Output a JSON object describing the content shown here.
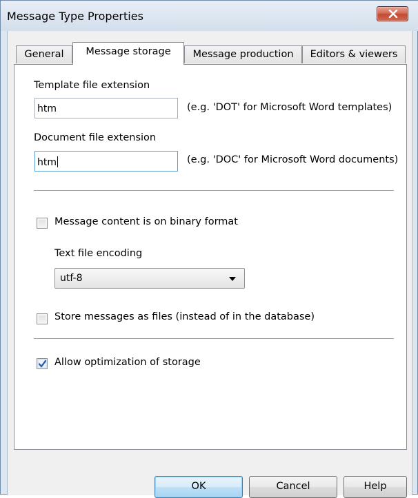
{
  "window": {
    "title": "Message Type Properties"
  },
  "tabs": [
    {
      "label": "General",
      "active": false
    },
    {
      "label": "Message storage",
      "active": true
    },
    {
      "label": "Message production",
      "active": false
    },
    {
      "label": "Editors & viewers",
      "active": false
    }
  ],
  "storage": {
    "template_label": "Template file extension",
    "template_value": "htm",
    "template_hint": "(e.g. 'DOT' for Microsoft Word templates)",
    "document_label": "Document file extension",
    "document_value": "htm",
    "document_hint": "(e.g. 'DOC' for Microsoft Word documents)",
    "binary_label": "Message content is on binary format",
    "binary_checked": false,
    "encoding_label": "Text file encoding",
    "encoding_value": "utf-8",
    "store_files_label": "Store messages as files (instead of in the database)",
    "store_files_checked": false,
    "optimize_label": "Allow optimization of storage",
    "optimize_checked": true
  },
  "buttons": {
    "ok": "OK",
    "cancel": "Cancel",
    "help": "Help"
  },
  "colors": {
    "accent_focus": "#5b9bd5",
    "close_red": "#c24a31",
    "check_blue": "#2c5ea8"
  },
  "icons": {
    "close": "close-icon",
    "dropdown": "chevron-down-icon",
    "check": "checkmark-icon"
  }
}
